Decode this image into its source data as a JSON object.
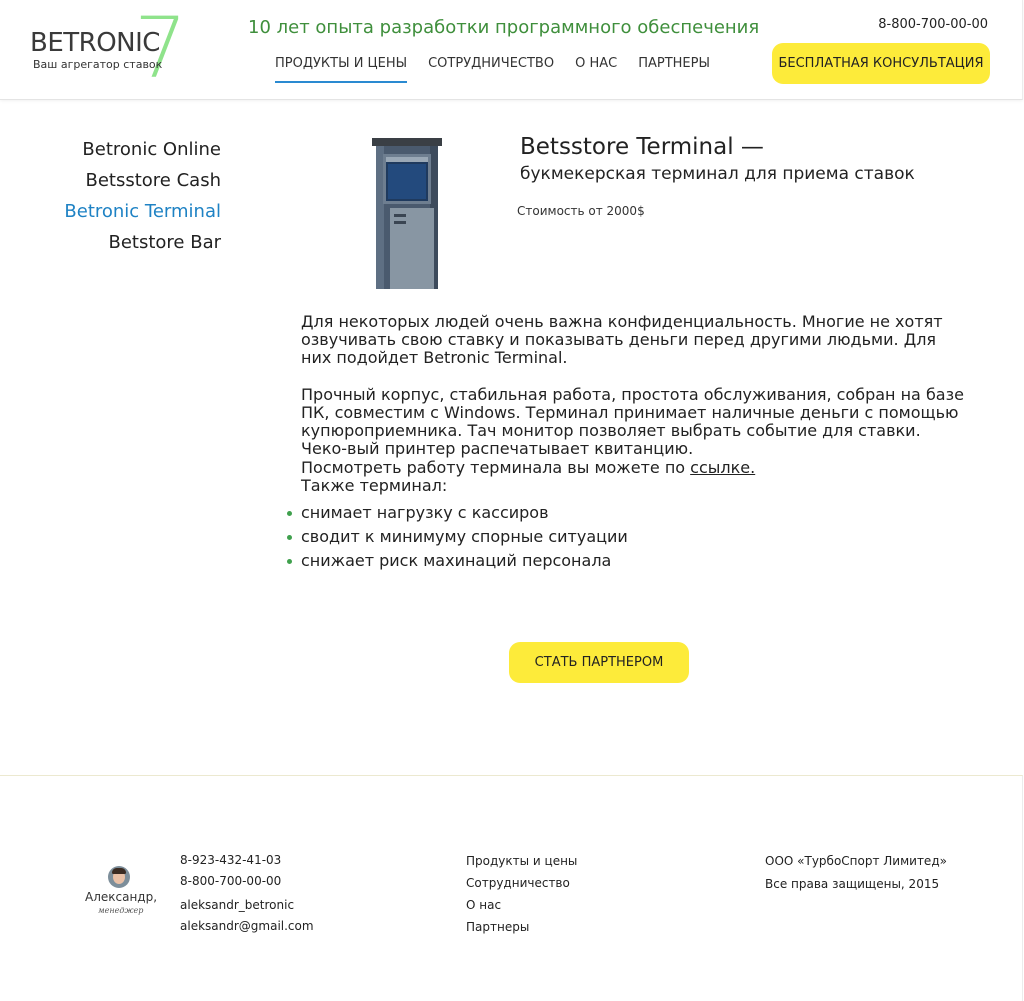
{
  "header": {
    "logo": {
      "word": "BETRONIC",
      "seven": "7",
      "sub": "Ваш агрегатор ставок"
    },
    "tagline": "10 лет опыта разработки программного обеспечения",
    "nav": [
      {
        "label": "ПРОДУКТЫ И ЦЕНЫ"
      },
      {
        "label": "СОТРУДНИЧЕСТВО"
      },
      {
        "label": "О НАС"
      },
      {
        "label": "ПАРТНЕРЫ"
      }
    ],
    "phone": "8-800-700-00-00",
    "consult_label": "БЕСПЛАТНАЯ КОНСУЛЬТАЦИЯ"
  },
  "sidebar": {
    "items": [
      {
        "label": "Betronic Online"
      },
      {
        "label": "Betsstore Cash"
      },
      {
        "label": "Betronic Terminal"
      },
      {
        "label": "Betstore Bar"
      }
    ]
  },
  "product": {
    "title": "Betsstore Terminal —",
    "subtitle": "букмекерская терминал для приема ставок",
    "price": "Стоимость от 2000$",
    "p1": "Для некоторых людей очень важна конфиденциальность. Многие не хотят озвучивать свою ставку и показывать деньги перед другими людьми. Для них подойдет Betronic Terminal.",
    "p2": "Прочный корпус, стабильная работа, простота обслуживания, собран на базе ПК, совместим с Windows. Терминал принимает наличные деньги с помощью купюроприемника. Тач монитор позволяет выбрать событие для ставки. Чеко-вый принтер распечатывает квитанцию.",
    "link_prefix": "Посмотреть работу терминала вы можете по ",
    "link_text": "ссылке.",
    "also_title": "Также терминал:",
    "bullets": [
      "снимает нагрузку с кассиров",
      "сводит к минимуму спорные ситуации",
      "снижает риск махинаций персонала"
    ],
    "partner_label": "СТАТЬ ПАРТНЕРОМ"
  },
  "footer": {
    "manager_name": "Александр,",
    "manager_role": "менеджер",
    "contacts": [
      "8-923-432-41-03",
      "8-800-700-00-00",
      "aleksandr_betronic",
      "aleksandr@gmail.com"
    ],
    "nav": [
      "Продукты и цены",
      "Сотрудничество",
      "О нас",
      "Партнеры"
    ],
    "company": "ООО «ТурбоСпорт Лимитед»",
    "rights": "Все права защищены, 2015"
  }
}
